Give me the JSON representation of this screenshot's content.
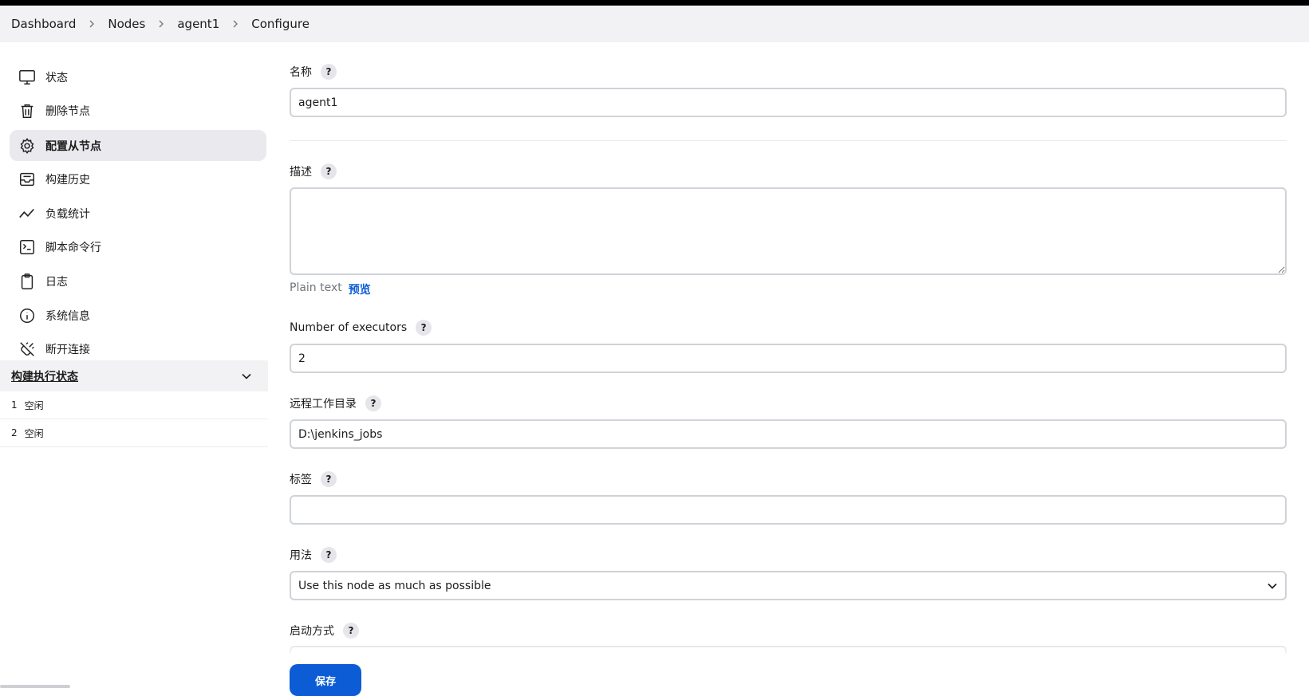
{
  "breadcrumb": [
    "Dashboard",
    "Nodes",
    "agent1",
    "Configure"
  ],
  "sidebar": {
    "items": [
      {
        "label": "状态",
        "icon": "monitor-icon",
        "active": false
      },
      {
        "label": "删除节点",
        "icon": "trash-icon",
        "active": false
      },
      {
        "label": "配置从节点",
        "icon": "gear-icon",
        "active": true
      },
      {
        "label": "构建历史",
        "icon": "inbox-icon",
        "active": false
      },
      {
        "label": "负载统计",
        "icon": "trend-icon",
        "active": false
      },
      {
        "label": "脚本命令行",
        "icon": "terminal-icon",
        "active": false
      },
      {
        "label": "日志",
        "icon": "clipboard-icon",
        "active": false
      },
      {
        "label": "系统信息",
        "icon": "info-icon",
        "active": false
      },
      {
        "label": "断开连接",
        "icon": "disconnect-icon",
        "active": false
      }
    ]
  },
  "executor_status": {
    "title": "构建执行状态",
    "rows": [
      {
        "num": "1",
        "state": "空闲"
      },
      {
        "num": "2",
        "state": "空闲"
      }
    ]
  },
  "form": {
    "name": {
      "label": "名称",
      "value": "agent1"
    },
    "description": {
      "label": "描述",
      "value": "",
      "format_text": "Plain text",
      "preview_label": "预览"
    },
    "executors": {
      "label": "Number of executors",
      "value": "2"
    },
    "remote_dir": {
      "label": "远程工作目录",
      "value": "D:\\jenkins_jobs"
    },
    "labels": {
      "label": "标签",
      "value": ""
    },
    "usage": {
      "label": "用法",
      "value": "Use this node as much as possible"
    },
    "launch": {
      "label": "启动方式"
    },
    "help_glyph": "?"
  },
  "save_label": "保存",
  "colors": {
    "accent": "#0b5cd5",
    "breadcrumb_bg": "#f2f2f4",
    "active_bg": "#e9e9ee"
  }
}
